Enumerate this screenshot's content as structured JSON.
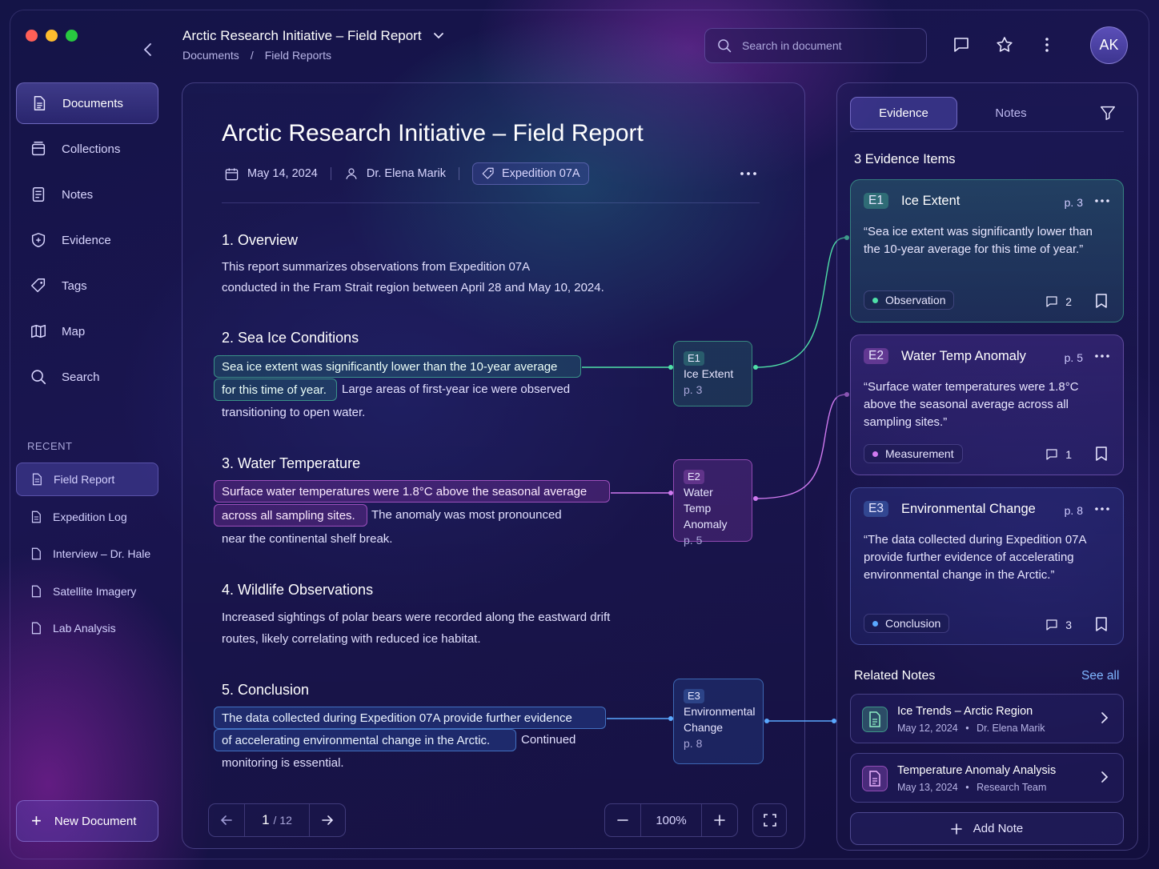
{
  "window": {
    "controls": {
      "close": "#ff5f57",
      "minimize": "#febc2e",
      "maximize": "#28c840"
    }
  },
  "header": {
    "title": "Arctic Research Initiative – Field Report",
    "breadcrumb": [
      "Documents",
      "/",
      "Field Reports"
    ],
    "search_placeholder": "Search in document",
    "avatar_initials": "AK"
  },
  "sidebar": {
    "items": [
      {
        "label": "Documents",
        "icon": "document-icon"
      },
      {
        "label": "Collections",
        "icon": "collections-icon"
      },
      {
        "label": "Notes",
        "icon": "notes-icon"
      },
      {
        "label": "Evidence",
        "icon": "shield-icon"
      },
      {
        "label": "Tags",
        "icon": "tag-icon"
      },
      {
        "label": "Map",
        "icon": "map-icon"
      },
      {
        "label": "Search",
        "icon": "search-icon"
      }
    ],
    "recent_label": "RECENT",
    "recent": [
      "Field Report",
      "Expedition Log",
      "Interview – Dr. Hale",
      "Satellite Imagery",
      "Lab Analysis"
    ],
    "new_document_label": "New Document"
  },
  "document": {
    "title": "Arctic Research Initiative – Field Report",
    "date": "May 14, 2024",
    "author": "Dr. Elena Marik",
    "tag": "Expedition 07A",
    "sections": {
      "s1": {
        "title": "1. Overview",
        "line1": "This report summarizes observations from Expedition 07A",
        "line2": "conducted in the Fram Strait region between April 28 and May 10, 2024."
      },
      "s2": {
        "title": "2. Sea Ice Conditions",
        "hl1": "Sea ice extent was significantly lower than the 10-year average",
        "hl2": "for this time of year.",
        "rest": "Large areas of first-year ice were observed",
        "line3": "transitioning to open water."
      },
      "s3": {
        "title": "3. Water Temperature",
        "hl1": "Surface water temperatures were 1.8°C above the seasonal average",
        "hl2": "across all sampling sites.",
        "rest": "The anomaly was most pronounced",
        "line3": "near the continental shelf break."
      },
      "s4": {
        "title": "4. Wildlife Observations",
        "line1": "Increased sightings of polar bears were recorded along the eastward drift",
        "line2": "routes, likely correlating with reduced ice habitat."
      },
      "s5": {
        "title": "5. Conclusion",
        "hl1": "The data collected during Expedition 07A provide further evidence",
        "hl2": "of accelerating environmental change in the Arctic.",
        "rest": "Continued",
        "line3": "monitoring is essential."
      }
    },
    "inline_tags": {
      "e1": {
        "code": "E1",
        "line1": "Ice Extent",
        "page": "p. 3"
      },
      "e2": {
        "code": "E2",
        "line1": "Water Temp",
        "line2": "Anomaly",
        "page": "p. 5"
      },
      "e3": {
        "code": "E3",
        "line1": "Environmental",
        "line2": "Change",
        "page": "p. 8"
      }
    },
    "pager": {
      "current": "1",
      "total": "/ 12"
    },
    "zoom": "100%"
  },
  "right_panel": {
    "tabs": [
      "Evidence",
      "Notes"
    ],
    "count_label": "3 Evidence Items",
    "cards": [
      {
        "code": "E1",
        "title": "Ice Extent",
        "page": "p. 3",
        "quote": "“Sea ice extent was significantly lower than the 10-year average for this time of year.”",
        "category": "Observation",
        "category_color": "#4fe0a8",
        "comments": "2"
      },
      {
        "code": "E2",
        "title": "Water Temp Anomaly",
        "page": "p. 5",
        "quote": "“Surface water temperatures were 1.8°C above the seasonal average across all sampling sites.”",
        "category": "Measurement",
        "category_color": "#d07af0",
        "comments": "1"
      },
      {
        "code": "E3",
        "title": "Environmental Change",
        "page": "p. 8",
        "quote": "“The data collected during Expedition 07A provide further evidence of accelerating environmental change in the Arctic.”",
        "category": "Conclusion",
        "category_color": "#5aa8ff",
        "comments": "3"
      }
    ],
    "related_title": "Related Notes",
    "see_all": "See all",
    "notes": [
      {
        "title": "Ice Trends – Arctic Region",
        "date": "May 12, 2024",
        "dot": "•",
        "author": "Dr. Elena Marik"
      },
      {
        "title": "Temperature Anomaly Analysis",
        "date": "May 13, 2024",
        "dot": "•",
        "author": "Research Team"
      }
    ],
    "add_note_label": "Add Note"
  }
}
